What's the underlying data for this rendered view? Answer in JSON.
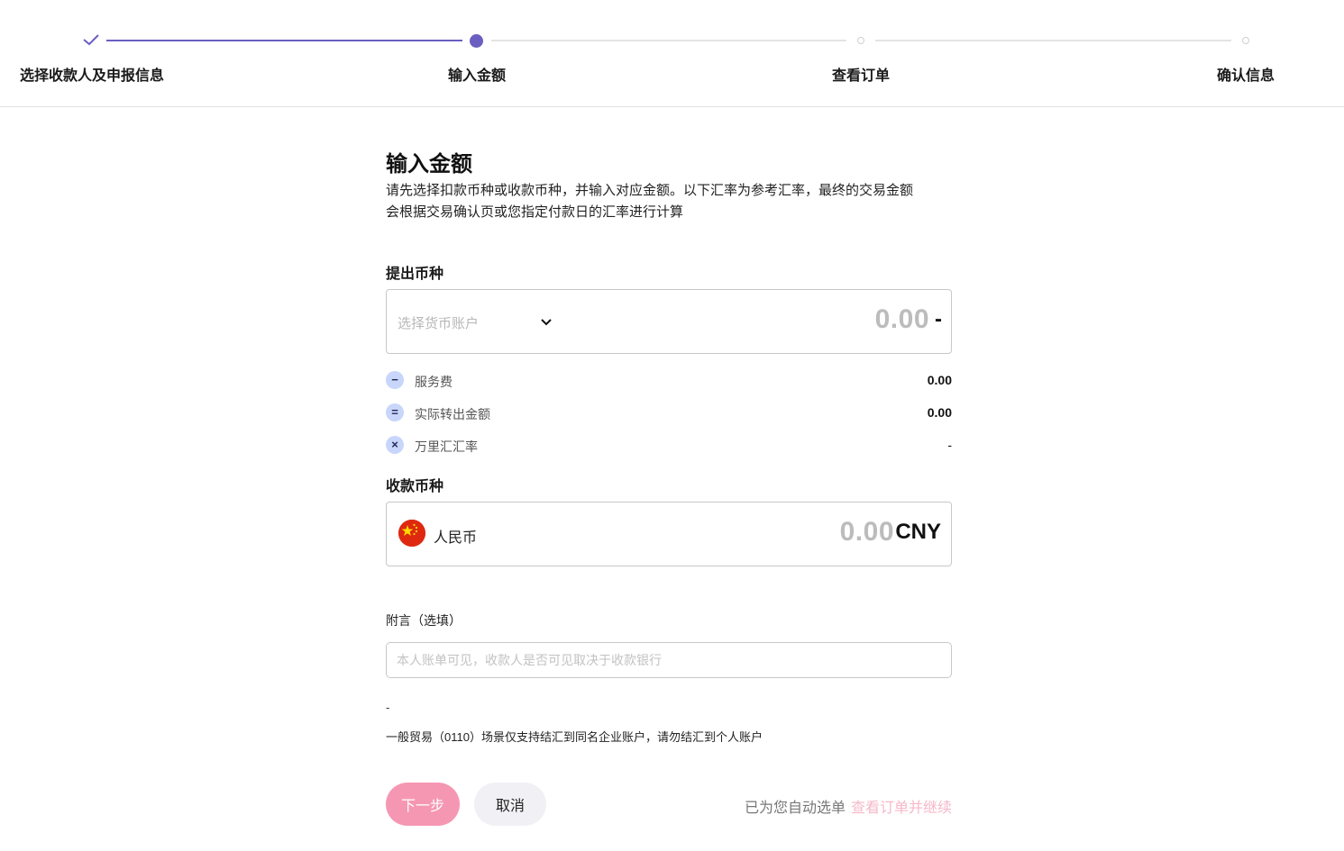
{
  "stepper": {
    "steps": [
      {
        "label": "选择收款人及申报信息",
        "state": "done"
      },
      {
        "label": "输入金额",
        "state": "active"
      },
      {
        "label": "查看订单",
        "state": "pending"
      },
      {
        "label": "确认信息",
        "state": "pending"
      }
    ],
    "accent_color": "#6a5fc1"
  },
  "main": {
    "title": "输入金额",
    "description_line1": "请先选择扣款币种或收款币种，并输入对应金额。以下汇率为参考汇率，最终的交易金额",
    "description_line2": "会根据交易确认页或您指定付款日的汇率进行计算",
    "withdraw": {
      "label": "提出币种",
      "select_placeholder": "选择货币账户",
      "amount": "0.00",
      "currency": "-"
    },
    "fees": [
      {
        "icon": "minus-icon",
        "symbol": "−",
        "label": "服务费",
        "value": "0.00"
      },
      {
        "icon": "equals-icon",
        "symbol": "=",
        "label": "实际转出金额",
        "value": "0.00"
      },
      {
        "icon": "times-icon",
        "symbol": "×",
        "label": "万里汇汇率",
        "value": "-"
      }
    ],
    "receive": {
      "label": "收款币种",
      "currency_name": "人民币",
      "flag_icon": "china-flag-icon",
      "amount": "0.00",
      "currency": "CNY"
    },
    "note": {
      "label": "附言（选填）",
      "placeholder": "本人账单可见，收款人是否可见取决于收款银行",
      "value": ""
    },
    "dash_line": "-",
    "trade_notice": "一般贸易（0110）场景仅支持结汇到同名企业账户，请勿结汇到个人账户",
    "buttons": {
      "next": "下一步",
      "cancel": "取消"
    },
    "auto_select": {
      "text": "已为您自动选单",
      "link": "查看订单并继续"
    },
    "colors": {
      "primary_button": "#f597b3",
      "link": "#f6b8c9"
    }
  }
}
